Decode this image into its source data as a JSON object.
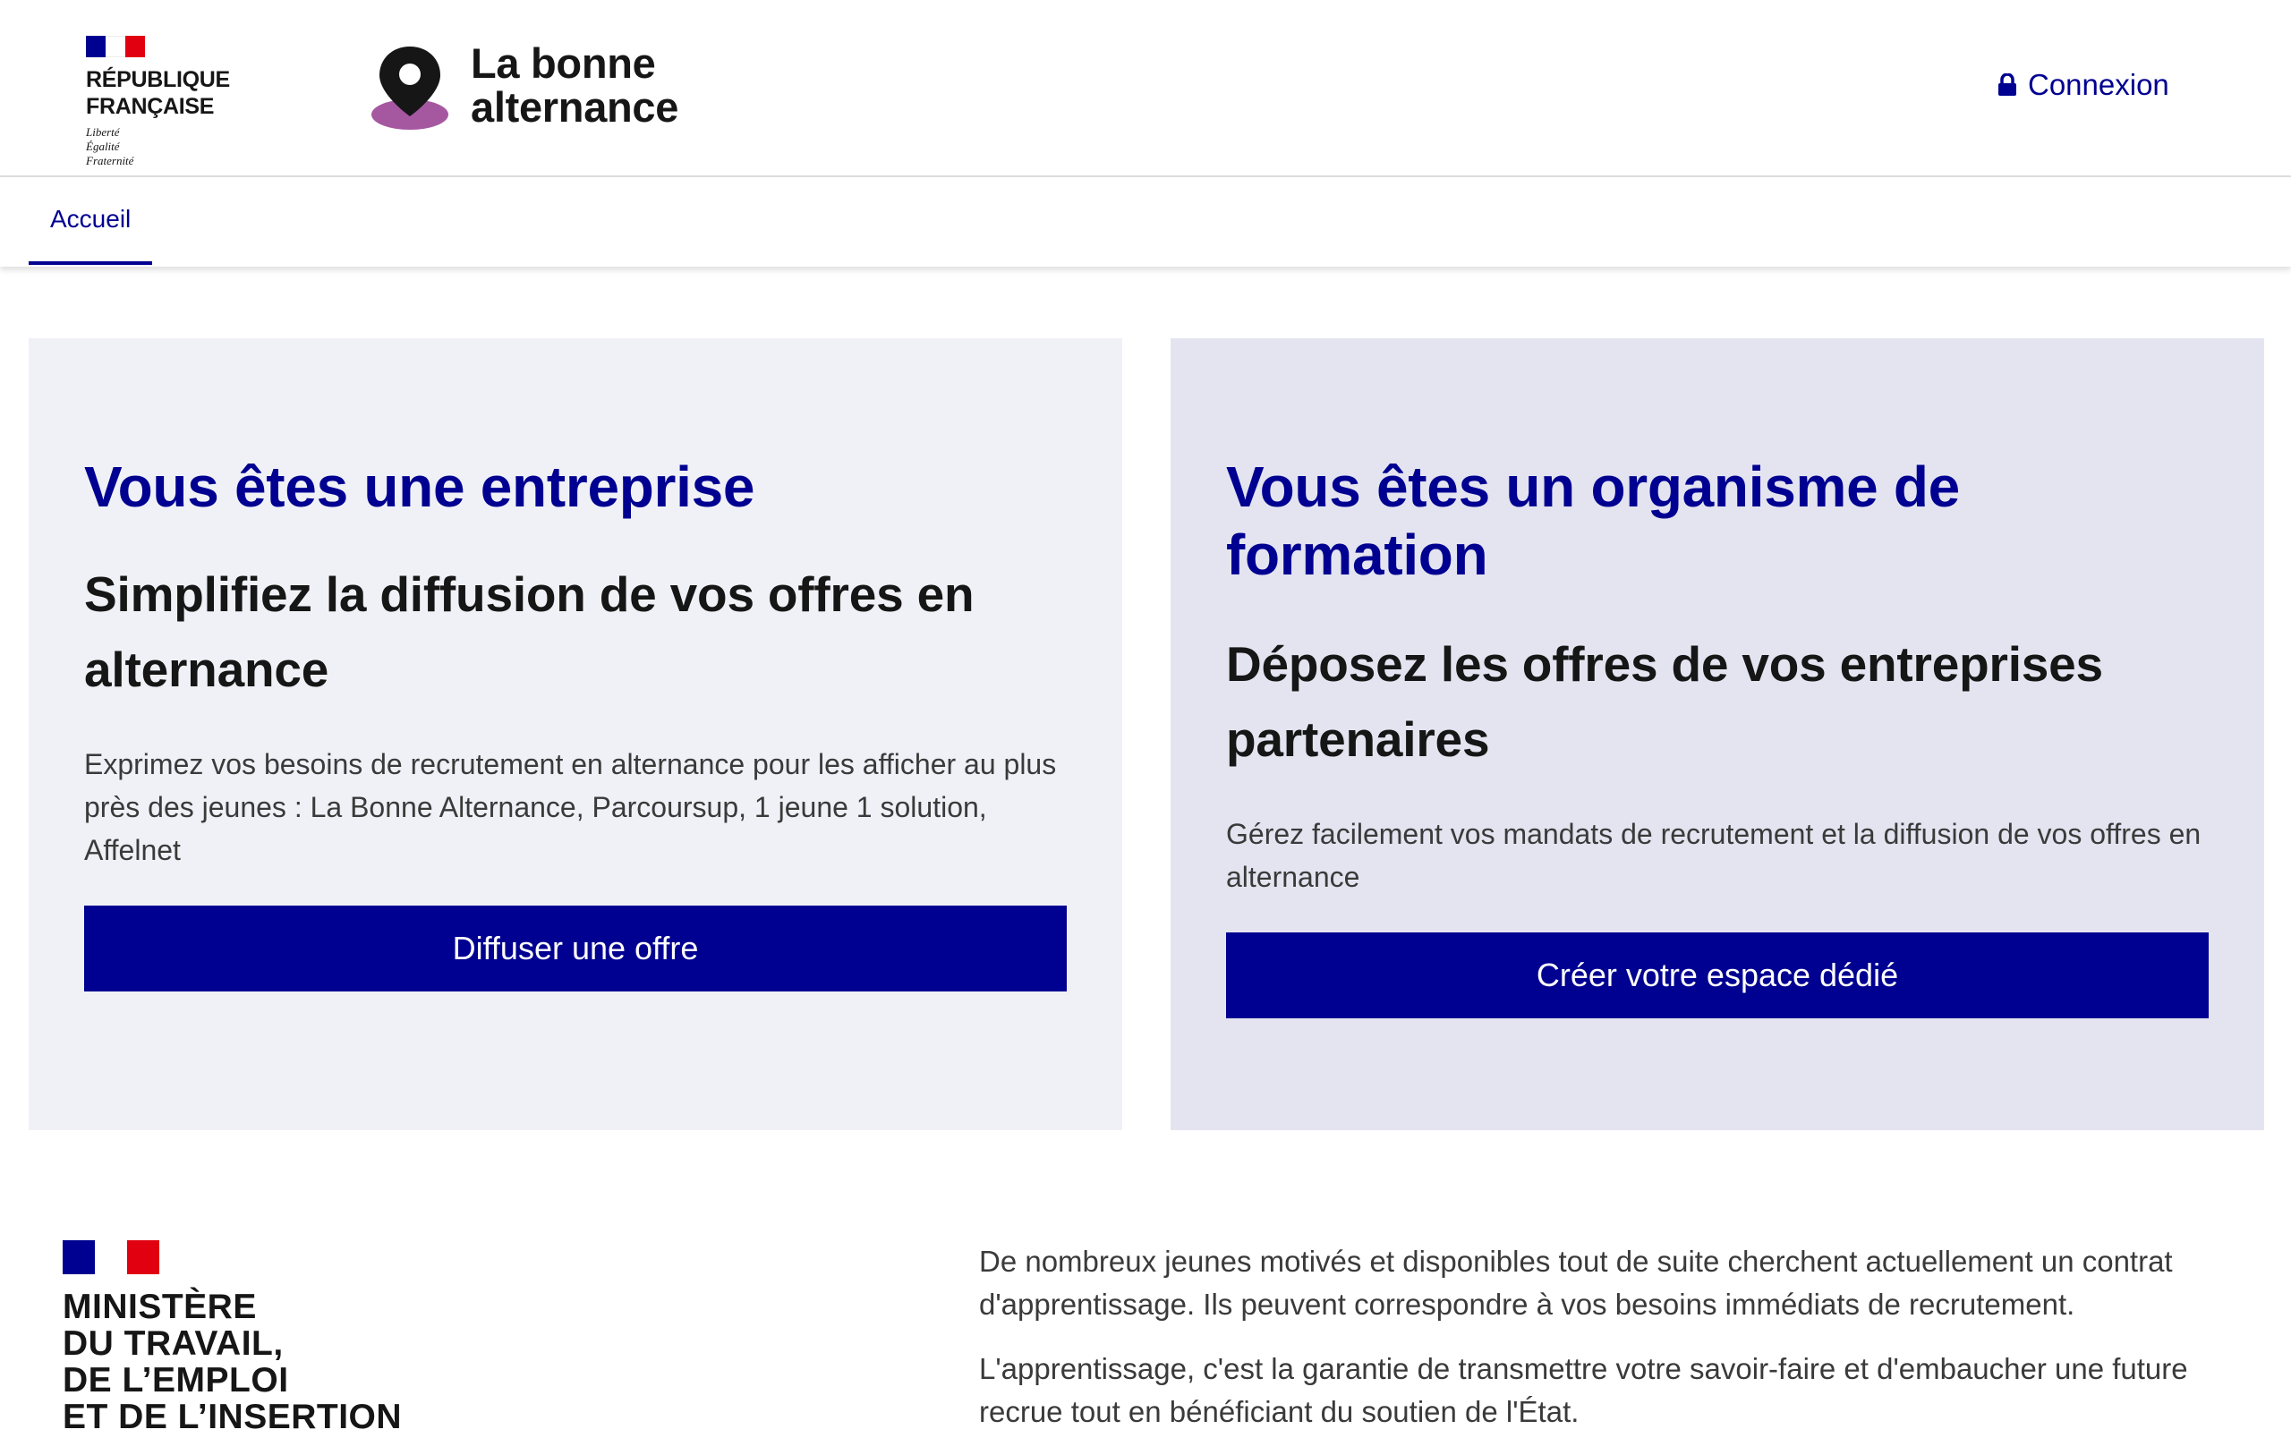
{
  "header": {
    "republic": "RÉPUBLIQUE FRANÇAISE",
    "motto": [
      "Liberté",
      "Égalité",
      "Fraternité"
    ],
    "app_title_line1": "La bonne",
    "app_title_line2": "alternance",
    "login_label": "Connexion",
    "login_icon": "lock-icon",
    "logo_icon": "map-pin-icon"
  },
  "nav": {
    "tabs": [
      {
        "label": "Accueil",
        "active": true
      }
    ]
  },
  "cards": {
    "company": {
      "title": "Vous êtes une entreprise",
      "subtitle": "Simplifiez la diffusion de vos offres en alternance",
      "text": "Exprimez vos besoins de recrutement en alternance pour les afficher au plus près des jeunes : La Bonne Alternance, Parcoursup, 1 jeune 1 solution, Affelnet",
      "button": "Diffuser une offre"
    },
    "training": {
      "title": "Vous êtes un organisme de formation",
      "subtitle": "Déposez les offres de vos entreprises partenaires",
      "text": "Gérez facilement vos mandats de recrutement et la diffusion de vos offres en alternance",
      "button": "Créer votre espace dédié"
    }
  },
  "ministry": {
    "lines": [
      "MINISTÈRE",
      "DU TRAVAIL,",
      "DE L’EMPLOI",
      "ET DE L’INSERTION"
    ]
  },
  "footer": {
    "p1": "De nombreux jeunes motivés et disponibles tout de suite cherchent actuellement un contrat d'apprentissage. Ils peuvent correspondre à vos besoins immédiats de recrutement.",
    "p2": "L'apprentissage, c'est la garantie de transmettre votre savoir-faire et d'embaucher une future recrue tout en bénéficiant du soutien de l'État."
  },
  "colors": {
    "accent": "#000091",
    "card_left_bg": "#f0f1f7",
    "card_right_bg": "#e4e4f1",
    "pin_base": "#a558a0"
  }
}
